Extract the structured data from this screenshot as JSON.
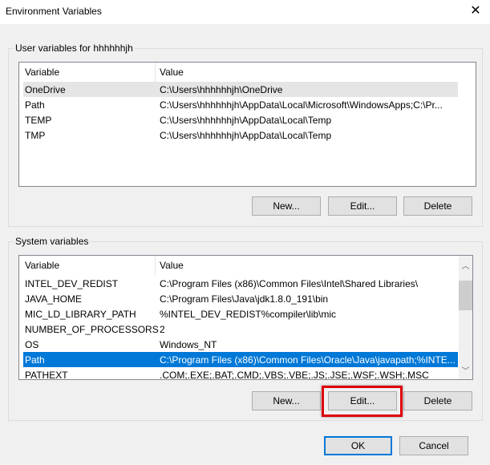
{
  "window": {
    "title": "Environment Variables",
    "close_icon": "close-icon"
  },
  "user": {
    "group_label": "User variables for hhhhhhjh",
    "columns": [
      "Variable",
      "Value"
    ],
    "rows": [
      {
        "variable": "OneDrive",
        "value": "C:\\Users\\hhhhhhjh\\OneDrive"
      },
      {
        "variable": "Path",
        "value": "C:\\Users\\hhhhhhjh\\AppData\\Local\\Microsoft\\WindowsApps;C:\\Pr..."
      },
      {
        "variable": "TEMP",
        "value": "C:\\Users\\hhhhhhjh\\AppData\\Local\\Temp"
      },
      {
        "variable": "TMP",
        "value": "C:\\Users\\hhhhhhjh\\AppData\\Local\\Temp"
      }
    ],
    "buttons": {
      "new": "New...",
      "edit": "Edit...",
      "delete": "Delete"
    }
  },
  "system": {
    "group_label": "System variables",
    "columns": [
      "Variable",
      "Value"
    ],
    "rows": [
      {
        "variable": "INTEL_DEV_REDIST",
        "value": "C:\\Program Files (x86)\\Common Files\\Intel\\Shared Libraries\\"
      },
      {
        "variable": "JAVA_HOME",
        "value": "C:\\Program Files\\Java\\jdk1.8.0_191\\bin"
      },
      {
        "variable": "MIC_LD_LIBRARY_PATH",
        "value": "%INTEL_DEV_REDIST%compiler\\lib\\mic"
      },
      {
        "variable": "NUMBER_OF_PROCESSORS",
        "value": "2"
      },
      {
        "variable": "OS",
        "value": "Windows_NT"
      },
      {
        "variable": "Path",
        "value": "C:\\Program Files (x86)\\Common Files\\Oracle\\Java\\javapath;%INTE...",
        "selected": true
      },
      {
        "variable": "PATHEXT",
        "value": ".COM;.EXE;.BAT;.CMD;.VBS;.VBE;.JS;.JSE;.WSF;.WSH;.MSC"
      }
    ],
    "buttons": {
      "new": "New...",
      "edit": "Edit...",
      "delete": "Delete"
    },
    "highlighted_button": "edit"
  },
  "footer": {
    "ok": "OK",
    "cancel": "Cancel"
  },
  "colors": {
    "selection": "#0078d7",
    "highlight": "#e0000a"
  }
}
